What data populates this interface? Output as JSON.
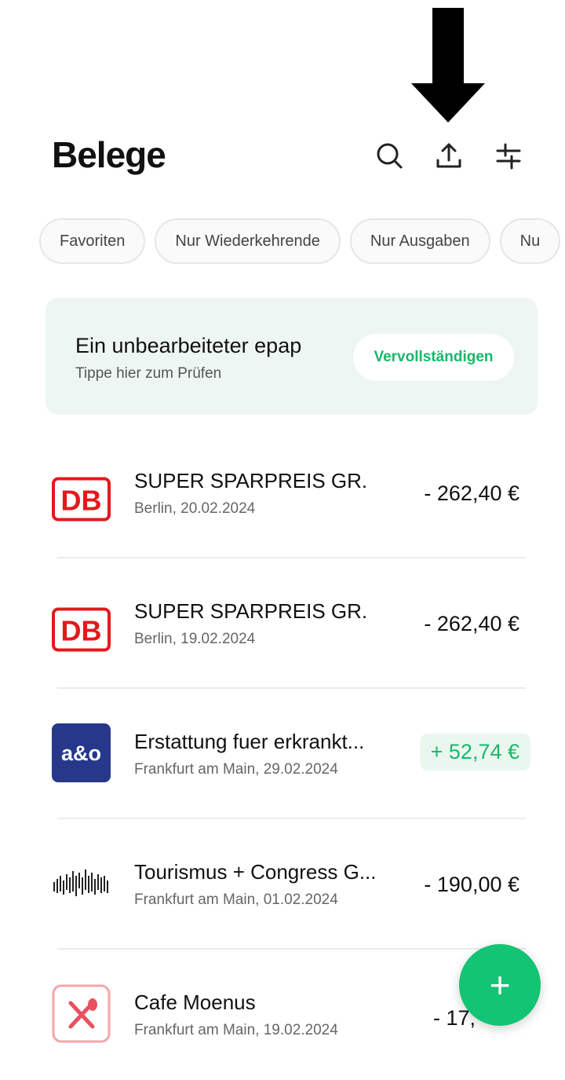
{
  "header": {
    "title": "Belege",
    "icons": [
      "search-icon",
      "upload-icon",
      "filter-icon"
    ]
  },
  "chips": [
    "Favoriten",
    "Nur Wiederkehrende",
    "Nur Ausgaben",
    "Nu"
  ],
  "banner": {
    "title": "Ein unbearbeiteter epap",
    "subtitle": "Tippe hier zum Prüfen",
    "button_label": "Vervollständigen"
  },
  "receipts": [
    {
      "logo": "DB",
      "title": "SUPER SPARPREIS GR.",
      "subtitle": "Berlin, 20.02.2024",
      "amount": "- 262,40 €"
    },
    {
      "logo": "DB",
      "title": "SUPER SPARPREIS GR.",
      "subtitle": "Berlin, 19.02.2024",
      "amount": "- 262,40 €"
    },
    {
      "logo": "a&o",
      "title": "Erstattung fuer erkrankt...",
      "subtitle": "Frankfurt am Main, 29.02.2024",
      "amount": "+ 52,74 €"
    },
    {
      "logo": "waveform",
      "title": "Tourismus + Congress G...",
      "subtitle": "Frankfurt am Main, 01.02.2024",
      "amount": "- 190,00 €"
    },
    {
      "logo": "restaurant",
      "title": "Cafe Moenus",
      "subtitle": "Frankfurt am Main, 19.02.2024",
      "amount": "- 17,"
    }
  ],
  "fab": {
    "label": "+"
  },
  "colors": {
    "accent": "#12c473",
    "positive": "#19b86b",
    "db_red": "#e3191c",
    "ao_blue": "#27388a"
  }
}
